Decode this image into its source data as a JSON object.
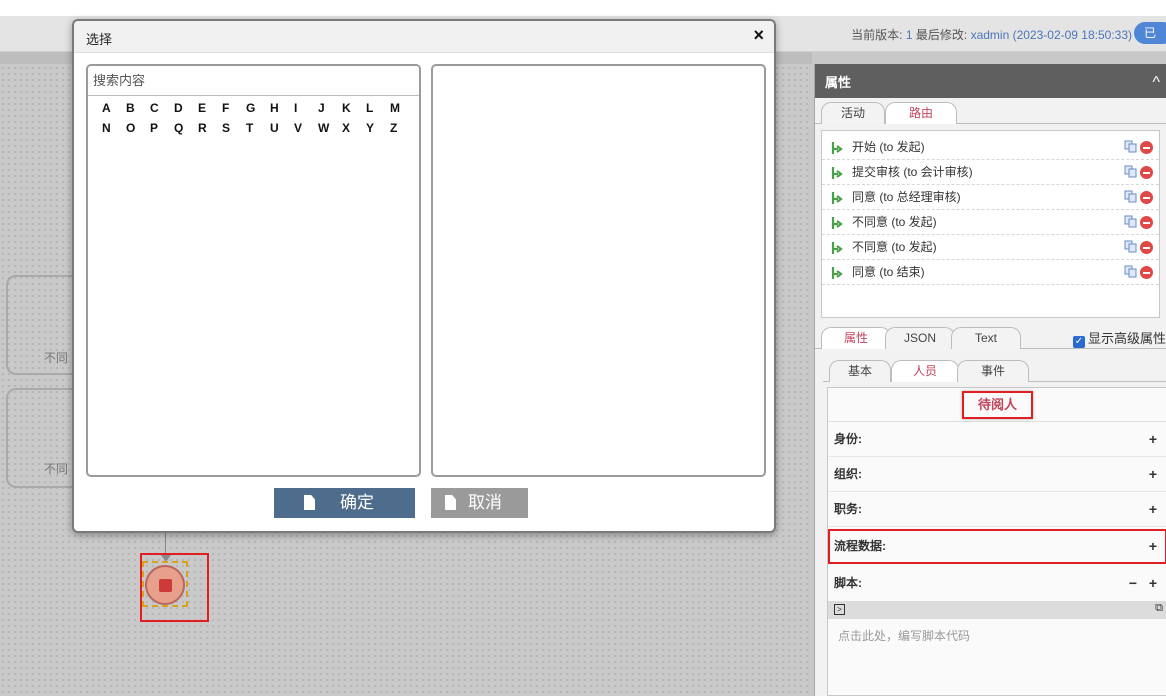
{
  "header": {
    "version_label": "当前版本:",
    "version_num": "1",
    "modified_label": "最后修改:",
    "modified_by": "xadmin (2023-02-09 18:50:33)",
    "badge": "已"
  },
  "canvas": {
    "node_labels": [
      "不同",
      "不同"
    ]
  },
  "panel": {
    "title": "属性",
    "top_tabs": [
      "活动",
      "路由"
    ],
    "routes": [
      "开始 (to 发起)",
      "提交审核 (to 会计审核)",
      "同意 (to 总经理审核)",
      "不同意 (to 发起)",
      "不同意 (to 发起)",
      "同意 (to 结束)"
    ],
    "prop_tabs": [
      "属性",
      "JSON",
      "Text"
    ],
    "advanced_label": "显示高级属性",
    "sub_tabs": [
      "基本",
      "人员",
      "事件"
    ],
    "group_title": "待阅人",
    "rows": {
      "identity": "身份:",
      "org": "组织:",
      "duty": "职务:",
      "flow_data": "流程数据:",
      "script": "脚本:"
    },
    "script_placeholder": "点击此处，编写脚本代码"
  },
  "dialog": {
    "title": "选择",
    "close": "×",
    "search_placeholder": "搜索内容",
    "letters_row1": [
      "A",
      "B",
      "C",
      "D",
      "E",
      "F",
      "G",
      "H",
      "I",
      "J",
      "K",
      "L",
      "M"
    ],
    "letters_row2": [
      "N",
      "O",
      "P",
      "Q",
      "R",
      "S",
      "T",
      "U",
      "V",
      "W",
      "X",
      "Y",
      "Z"
    ],
    "ok_label": "确定",
    "cancel_label": "取消"
  },
  "colors": {
    "accent_red": "#c0445b",
    "ok_button": "#4e6c8c",
    "cancel_button": "#9a9a9a",
    "highlight": "#e02020"
  }
}
